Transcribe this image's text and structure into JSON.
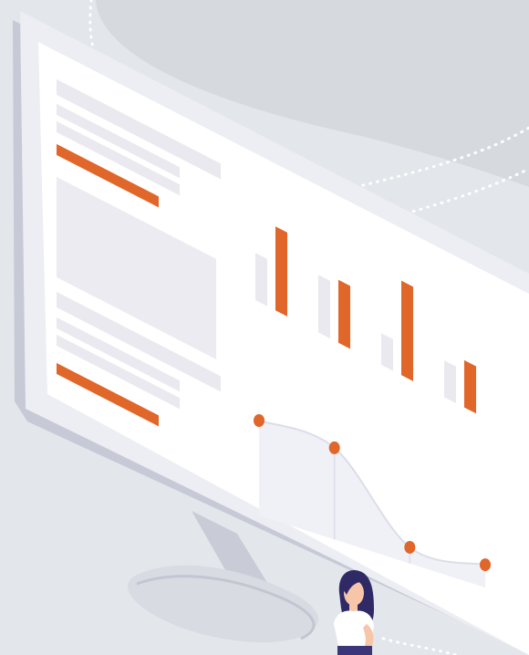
{
  "illustration": {
    "subject": "isometric-monitor-analytics-dashboard",
    "figure": "person-standing"
  },
  "colors": {
    "background": "#e3e6ea",
    "background_shape": "#d6dadf",
    "dotted_path": "#ffffff",
    "monitor_frame": "#eceef3",
    "monitor_edge": "#c7c9d6",
    "monitor_stand": "#d2d4de",
    "screen": "#ffffff",
    "placeholder_gray": "#e9e9ef",
    "accent_orange": "#e0662a",
    "chart_area": "#f0f0f7",
    "chart_line": "#dcdde8",
    "hair": "#2f2a66",
    "skin": "#f7c6a9",
    "shirt": "#ffffff",
    "pants": "#3b357a"
  },
  "screen_widgets": {
    "bar_chart": {
      "pairs": [
        {
          "ghost": 0.45,
          "accent": 0.8
        },
        {
          "ghost": 0.55,
          "accent": 0.6
        },
        {
          "ghost": 0.3,
          "accent": 0.9
        },
        {
          "ghost": 0.35,
          "accent": 0.45
        }
      ]
    },
    "line_chart": {
      "points": [
        0.55,
        0.62,
        0.25,
        0.38
      ]
    }
  }
}
